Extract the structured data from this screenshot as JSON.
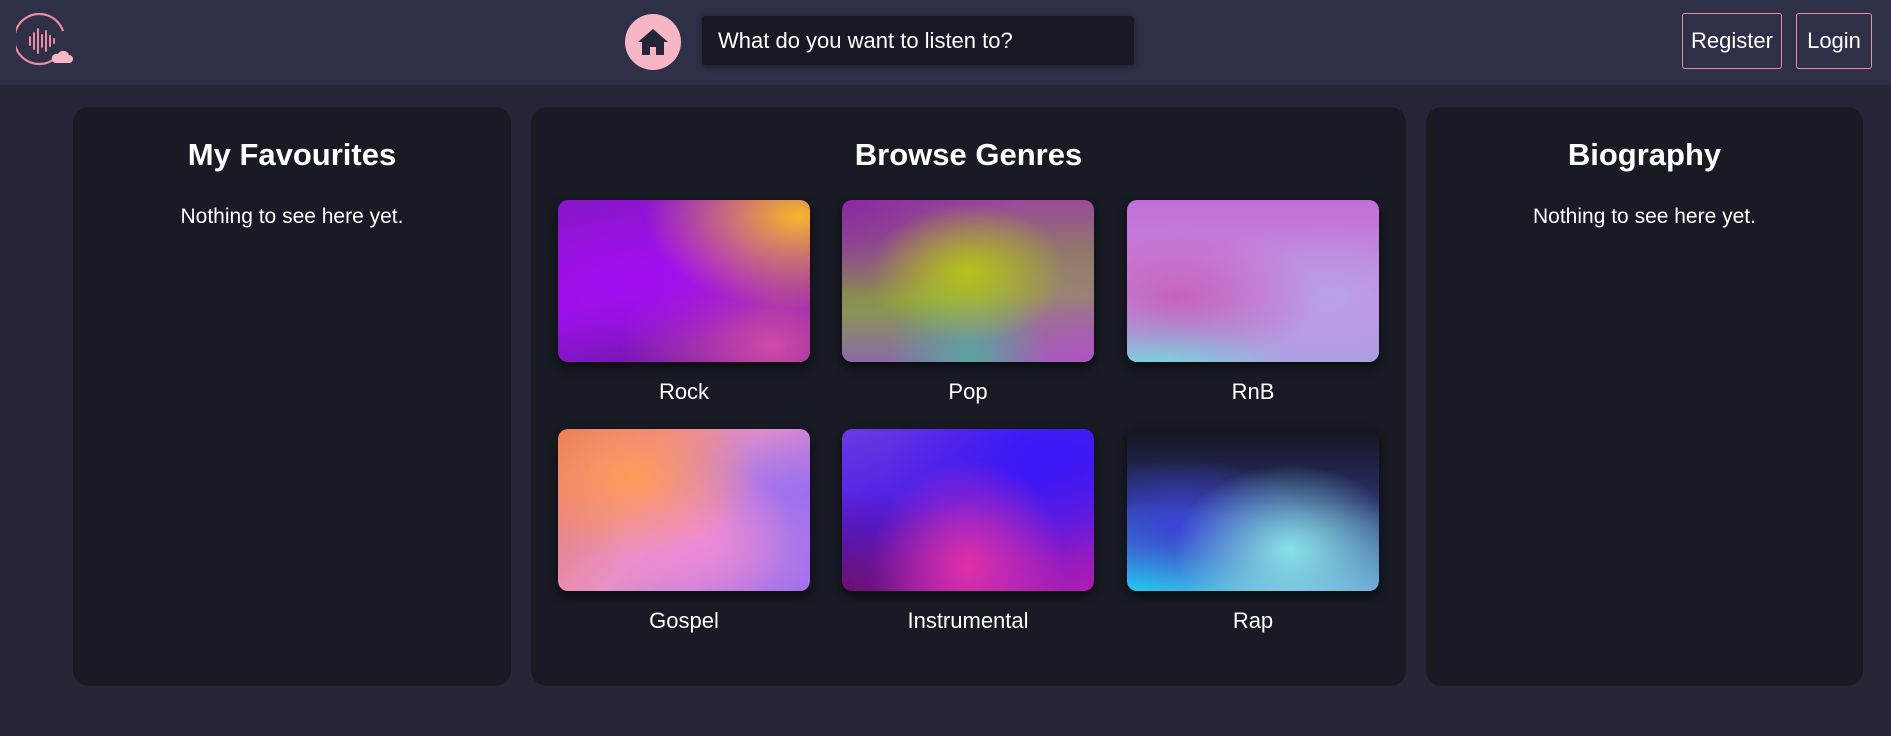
{
  "header": {
    "search_placeholder": "What do you want to listen to?",
    "register_label": "Register",
    "login_label": "Login",
    "accent_color": "#f7b6c5",
    "logo_icon": "soundwave-cloud-icon",
    "home_icon": "home-icon"
  },
  "favourites": {
    "title": "My Favourites",
    "empty_text": "Nothing to see here yet."
  },
  "genres": {
    "title": "Browse Genres",
    "items": [
      {
        "label": "Rock"
      },
      {
        "label": "Pop"
      },
      {
        "label": "RnB"
      },
      {
        "label": "Gospel"
      },
      {
        "label": "Instrumental"
      },
      {
        "label": "Rap"
      }
    ]
  },
  "biography": {
    "title": "Biography",
    "empty_text": "Nothing to see here yet."
  }
}
